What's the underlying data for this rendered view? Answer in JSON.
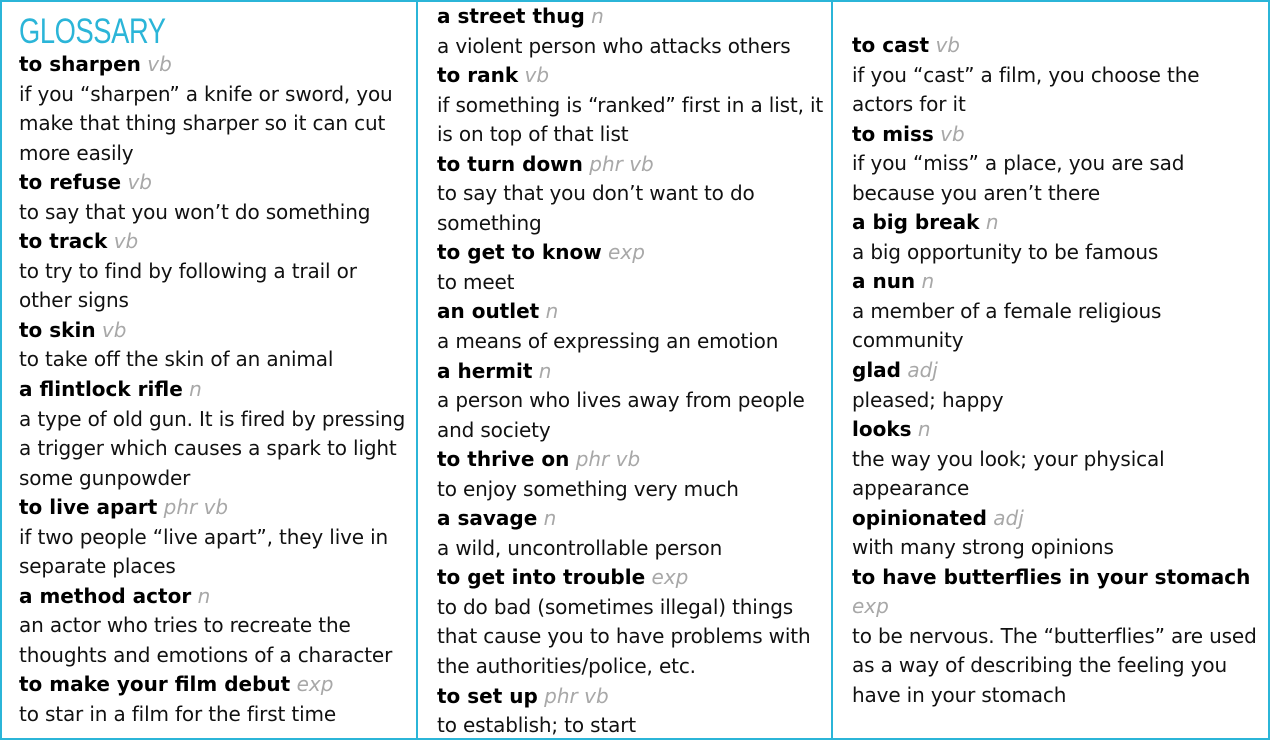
{
  "title": "GLOSSARY",
  "columns": [
    [
      {
        "term": "to sharpen",
        "pos": "vb",
        "def": "if you “sharpen” a knife or sword, you make that thing sharper so it can cut more easily"
      },
      {
        "term": "to refuse",
        "pos": "vb",
        "def": "to say that you won’t do something"
      },
      {
        "term": "to track",
        "pos": "vb",
        "def": "to try to find by following a trail or other signs"
      },
      {
        "term": "to skin",
        "pos": "vb",
        "def": "to take off the skin of an animal"
      },
      {
        "term": "a flintlock rifle",
        "pos": "n",
        "def": "a type of old gun. It is fired by pressing a trigger which causes a spark to light some gunpowder"
      },
      {
        "term": "to live apart",
        "pos": "phr vb",
        "def": "if two people “live apart”, they live in separate places"
      },
      {
        "term": "a method actor",
        "pos": "n",
        "def": "an actor who tries to recreate the thoughts and emotions of a character"
      },
      {
        "term": "to make your film debut",
        "pos": "exp",
        "def": "to star in a film for the first time"
      }
    ],
    [
      {
        "term": "a street thug",
        "pos": "n",
        "def": "a violent person who attacks others"
      },
      {
        "term": "to rank",
        "pos": "vb",
        "def": "if something is “ranked” first in a list, it is on top of that list"
      },
      {
        "term": "to turn down",
        "pos": "phr vb",
        "def": "to say that you don’t want to do something"
      },
      {
        "term": "to get to know",
        "pos": "exp",
        "def": "to meet"
      },
      {
        "term": "an outlet",
        "pos": "n",
        "def": "a means of expressing an emotion"
      },
      {
        "term": "a hermit",
        "pos": "n",
        "def": "a person who lives away from people and society"
      },
      {
        "term": "to thrive on",
        "pos": "phr vb",
        "def": "to enjoy something very much"
      },
      {
        "term": "a savage",
        "pos": "n",
        "def": "a wild, uncontrollable person"
      },
      {
        "term": "to get into trouble",
        "pos": "exp",
        "def": "to do bad (sometimes illegal) things that cause you to have problems with the authorities/police, etc."
      },
      {
        "term": "to set up",
        "pos": "phr vb",
        "def": "to establish; to start"
      }
    ],
    [
      {
        "term": "to cast",
        "pos": "vb",
        "def": "if you “cast” a film, you choose the actors for it"
      },
      {
        "term": "to miss",
        "pos": "vb",
        "def": "if you “miss” a place, you are sad because you aren’t there"
      },
      {
        "term": "a big break",
        "pos": "n",
        "def": "a big opportunity to be famous"
      },
      {
        "term": "a nun",
        "pos": "n",
        "def": "a member of a female religious community"
      },
      {
        "term": "glad",
        "pos": "adj",
        "def": "pleased; happy"
      },
      {
        "term": "looks",
        "pos": "n",
        "def": "the way you look; your physical appearance"
      },
      {
        "term": "opinionated",
        "pos": "adj",
        "def": "with many strong opinions"
      },
      {
        "term": "to have butterflies in your stomach",
        "pos": "exp",
        "def": "to be nervous. The “butterflies” are used as a way of describing the feeling you have in your stomach"
      }
    ]
  ]
}
